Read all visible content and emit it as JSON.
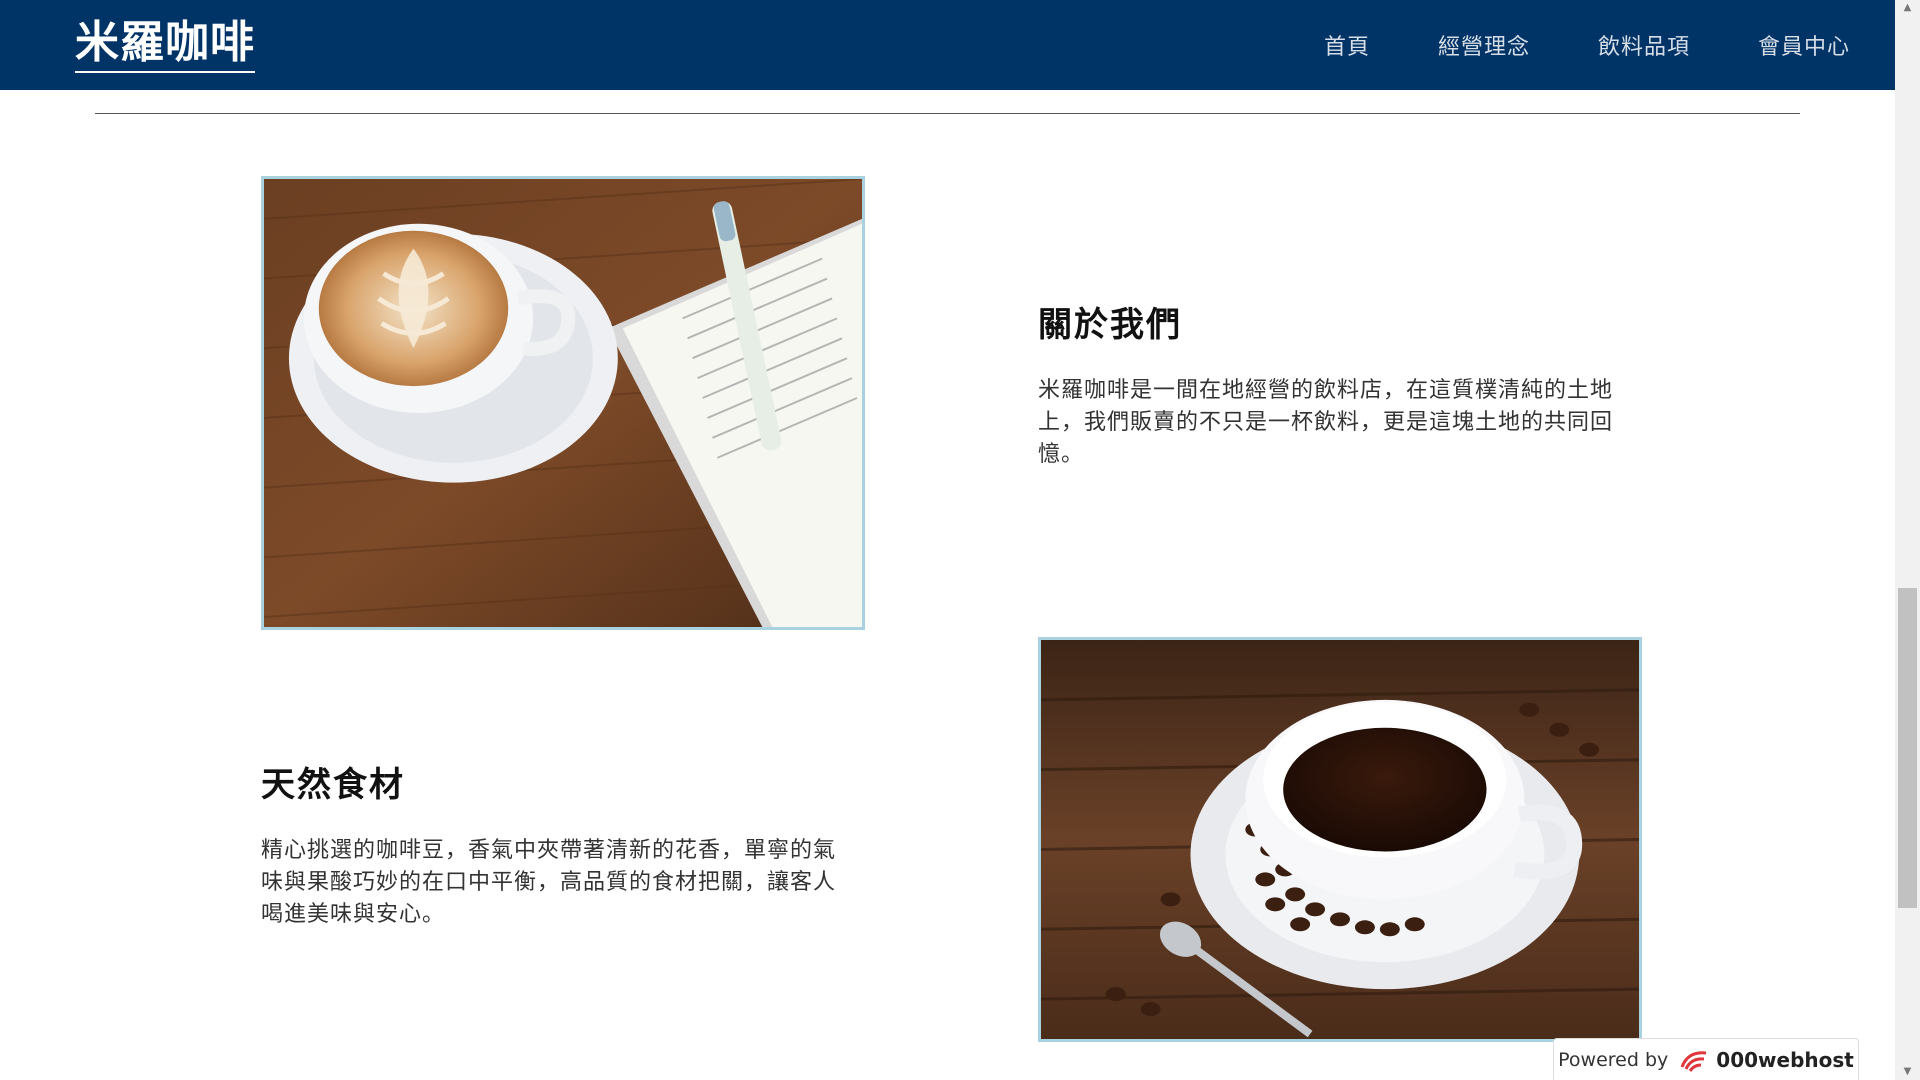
{
  "header": {
    "brand": "米羅咖啡",
    "nav": [
      "首頁",
      "經營理念",
      "飲料品項",
      "會員中心"
    ]
  },
  "sections": [
    {
      "title": "關於我們",
      "text": "米羅咖啡是一間在地經營的飲料店，在這質樸清純的土地上，我們販賣的不只是一杯飲料，更是這塊土地的共同回憶。",
      "image": "latte-art-coffee-cup-with-open-book"
    },
    {
      "title": "天然食材",
      "text": "精心挑選的咖啡豆，香氣中夾帶著清新的花香，單寧的氣味與果酸巧妙的在口中平衡，高品質的食材把關，讓客人喝進美味與安心。",
      "image": "black-coffee-cup-with-coffee-beans"
    }
  ],
  "footer": {
    "powered_label": "Powered by",
    "powered_brand": "000webhost"
  },
  "colors": {
    "navbar": "#003366",
    "image_border": "#a9d2e0"
  }
}
